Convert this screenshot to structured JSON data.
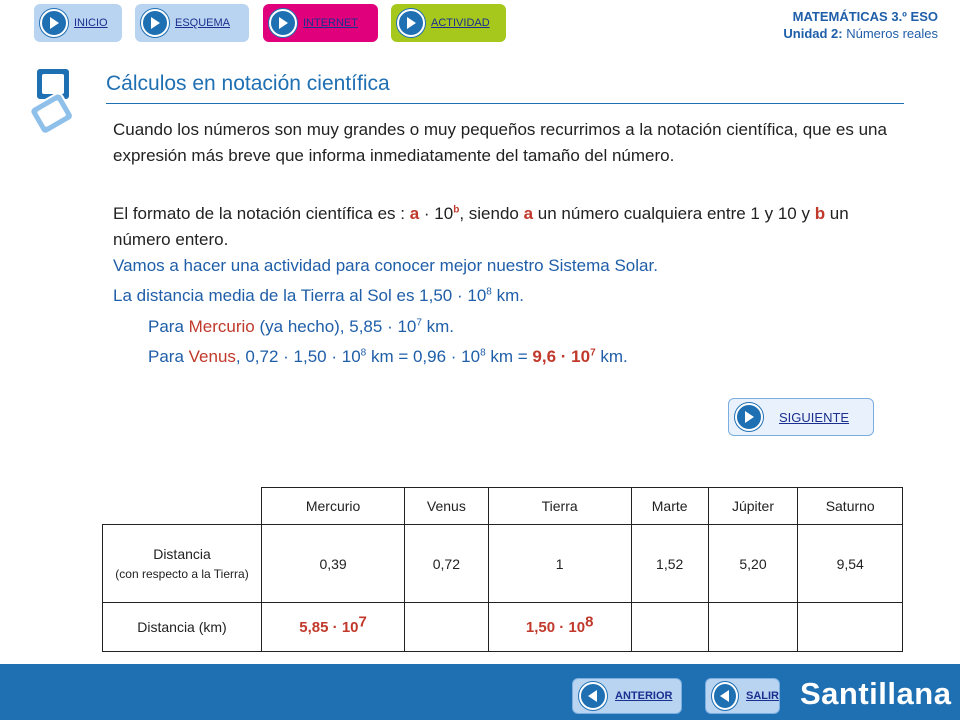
{
  "nav": {
    "inicio": "INICIO",
    "esquema": "ESQUEMA",
    "internet": "INTERNET",
    "actividad": "ACTIVIDAD"
  },
  "subject": {
    "course": "MATEMÁTICAS 3.º ESO",
    "unit_label": "Unidad 2:",
    "unit_name": "Números reales"
  },
  "title": "Cálculos en notación científica",
  "intro": "Cuando los números son muy grandes o muy pequeños recurrimos a la notación científica, que es una expresión más breve que informa inmediatamente del tamaño del número.",
  "format": {
    "pre": "El formato de la notación científica es : ",
    "a": "a",
    "dot": " · 10",
    "b": "b",
    "mid1": ", siendo ",
    "a2": "a",
    "mid2": " un número cualquiera entre 1 y 10 y ",
    "b2": "b",
    "end": " un número entero."
  },
  "activity": "Vamos a hacer una actividad para conocer mejor nuestro Sistema Solar.",
  "earth_sun": {
    "text": "La distancia media de la Tierra al Sol es 1,50 · 10",
    "exp": "8",
    "unit": " km."
  },
  "mercury": {
    "pre": "Para ",
    "planet": "Mercurio",
    "mid": " (ya hecho), 5,85 · 10",
    "exp": "7",
    "unit": " km."
  },
  "venus": {
    "pre": "Para ",
    "planet": "Venus",
    "mid": ", 0,72 · 1,50 · 10",
    "exp1": "8",
    "mid2": " km = 0,96 · 10",
    "exp2": "8",
    "mid3": " km  = ",
    "result": "9,6 · 10",
    "exp3": "7",
    "unit": " km."
  },
  "siguiente": "SIGUIENTE",
  "table": {
    "headers": [
      "Mercurio",
      "Venus",
      "Tierra",
      "Marte",
      "Júpiter",
      "Saturno"
    ],
    "row1_label": "Distancia",
    "row1_sub": "(con respecto a la Tierra)",
    "row1_values": [
      "0,39",
      "0,72",
      "1",
      "1,52",
      "5,20",
      "9,54"
    ],
    "row2_label": "Distancia (km)",
    "row2_mercurio": "5,85 · 10",
    "row2_mercurio_exp": "7",
    "row2_tierra": "1,50 · 10",
    "row2_tierra_exp": "8"
  },
  "bottom": {
    "anterior": "ANTERIOR",
    "salir": "SALIR",
    "brand": "Santillana"
  },
  "colors": {
    "primary_blue": "#1f6fb3",
    "accent_red": "#c0392b",
    "internet_pink": "#e0007b",
    "actividad_green": "#a6c81c"
  }
}
